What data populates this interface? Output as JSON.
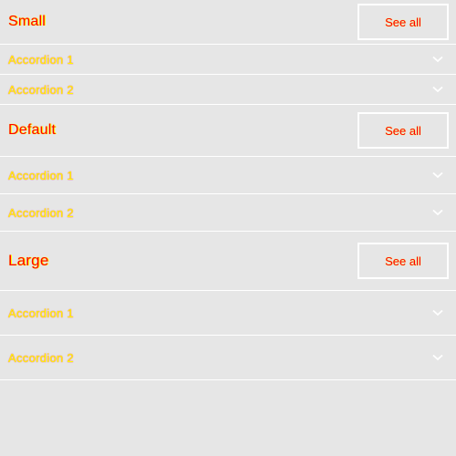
{
  "colors": {
    "background": "#e6e6e6",
    "divider": "#ffffff",
    "title_text": "#ff0000",
    "accordion_text": "#ffff00",
    "chevron": "#ffffff"
  },
  "sections": [
    {
      "title": "Small",
      "see_all_label": "See all",
      "accordions": [
        {
          "label": "Accordion 1",
          "icon": "chevron-down-icon"
        },
        {
          "label": "Accordion 2",
          "icon": "chevron-down-icon"
        }
      ]
    },
    {
      "title": "Default",
      "see_all_label": "See all",
      "accordions": [
        {
          "label": "Accordion 1",
          "icon": "chevron-down-icon"
        },
        {
          "label": "Accordion 2",
          "icon": "chevron-down-icon"
        }
      ]
    },
    {
      "title": "Large",
      "see_all_label": "See all",
      "accordions": [
        {
          "label": "Accordion 1",
          "icon": "chevron-down-icon"
        },
        {
          "label": "Accordion 2",
          "icon": "chevron-down-icon"
        }
      ]
    }
  ]
}
